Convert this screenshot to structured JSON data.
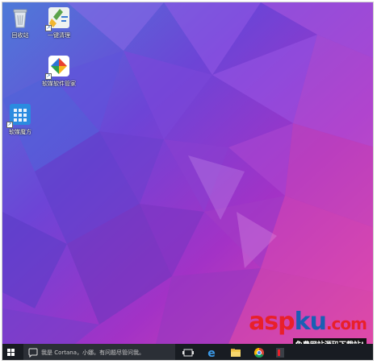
{
  "desktop": {
    "icons": [
      {
        "label": "回收站",
        "icon": "recycle-bin-icon"
      },
      {
        "label": "一键清理",
        "icon": "broom-cleanup-icon"
      },
      {
        "label": "软媒软件管家",
        "icon": "software-manager-icon"
      },
      {
        "label": "软媒魔方",
        "icon": "rubik-cube-icon"
      }
    ]
  },
  "taskbar": {
    "search_placeholder": "我是 Cortana，小娜。有问题尽管问我。",
    "apps": [
      "task-view-icon",
      "edge-browser-icon",
      "file-explorer-icon",
      "chrome-icon",
      "app-icon"
    ]
  },
  "watermark": {
    "brand_asp": "asp",
    "brand_ku": "ku",
    "brand_com": ".com",
    "tagline": "免费网站源码下载站!"
  },
  "colors": {
    "wallpaper_purple": "#7a2fd0",
    "wallpaper_pink": "#e23aa6",
    "taskbar": "#181c22",
    "watermark_red": "#e8202a",
    "watermark_blue": "#1a5fb4"
  }
}
